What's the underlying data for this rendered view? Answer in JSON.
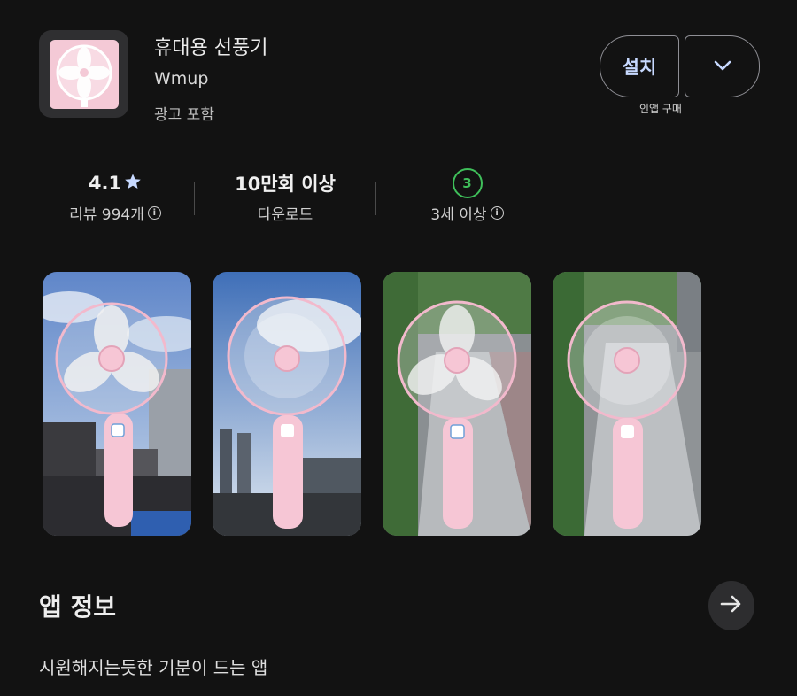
{
  "app": {
    "title": "휴대용 선풍기",
    "developer": "Wmup",
    "ads_label": "광고 포함",
    "icon": "pink-fan-icon"
  },
  "install": {
    "label": "설치",
    "more_icon": "chevron-down-icon",
    "in_app_note": "인앱 구매"
  },
  "stats": {
    "rating": {
      "value": "4.1",
      "icon": "star-icon",
      "label": "리뷰 994개"
    },
    "downloads": {
      "value": "10만회 이상",
      "label": "다운로드"
    },
    "age": {
      "badge": "3",
      "label": "3세 이상"
    }
  },
  "screenshots": [
    {
      "name": "fan-city-photo-1"
    },
    {
      "name": "fan-city-photo-2"
    },
    {
      "name": "fan-path-photo-1"
    },
    {
      "name": "fan-path-photo-2"
    }
  ],
  "about": {
    "title": "앱 정보",
    "arrow_icon": "arrow-right-icon",
    "description": "시원해지는듯한 기분이 드는 앱"
  },
  "colors": {
    "background": "#121212",
    "install_text": "#c7d9ff",
    "age_badge": "#3fbf5a",
    "fan_pink": "#f4c9d6"
  }
}
